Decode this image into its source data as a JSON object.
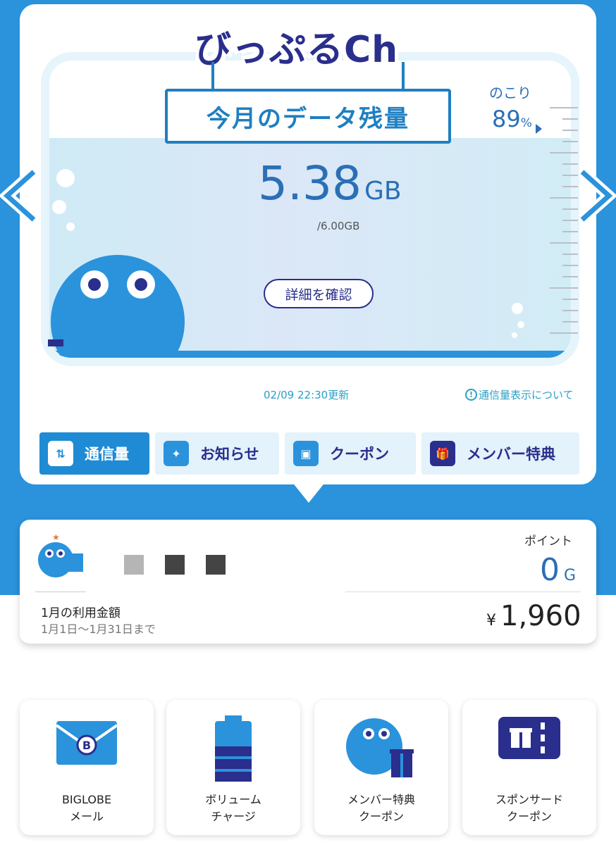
{
  "header": {
    "logo_text": "びっぷるCh",
    "sign_title": "今月のデータ残量"
  },
  "usage": {
    "remaining_label": "のこり",
    "remaining_percent": "89",
    "remaining_percent_unit": "%",
    "remaining_value": "5.38",
    "remaining_unit": "GB",
    "total": "/6.00GB",
    "detail_button": "詳細を確認",
    "updated": "02/09 22:30更新",
    "about_link": "通信量表示について",
    "about_icon": "!"
  },
  "tabs": [
    {
      "label": "通信量",
      "icon": "data-usage-icon",
      "glyph": "⇅",
      "active": true
    },
    {
      "label": "お知らせ",
      "icon": "sparkle-icon",
      "glyph": "✦",
      "active": false
    },
    {
      "label": "クーポン",
      "icon": "ticket-icon",
      "glyph": "▣",
      "active": false
    },
    {
      "label": "メンバー特典",
      "icon": "gift-icon",
      "glyph": "🎁",
      "active": false
    }
  ],
  "account": {
    "points_label": "ポイント",
    "points_value": "0",
    "points_unit": "G",
    "bill_title": "1月の利用金額",
    "bill_period": "1月1日〜1月31日まで",
    "bill_currency": "¥",
    "bill_amount": "1,960"
  },
  "shortcuts": [
    {
      "label": "BIGLOBE\nメール",
      "icon": "mail-icon"
    },
    {
      "label": "ボリューム\nチャージ",
      "icon": "battery-icon"
    },
    {
      "label": "メンバー特典\nクーポン",
      "icon": "mascot-gift-icon"
    },
    {
      "label": "スポンサード\nクーポン",
      "icon": "gift-ticket-icon"
    }
  ],
  "colors": {
    "brand_blue": "#2a93dc",
    "navy": "#2a2e8c",
    "text_blue": "#2b6fb6",
    "link_teal": "#2aa0c4"
  }
}
